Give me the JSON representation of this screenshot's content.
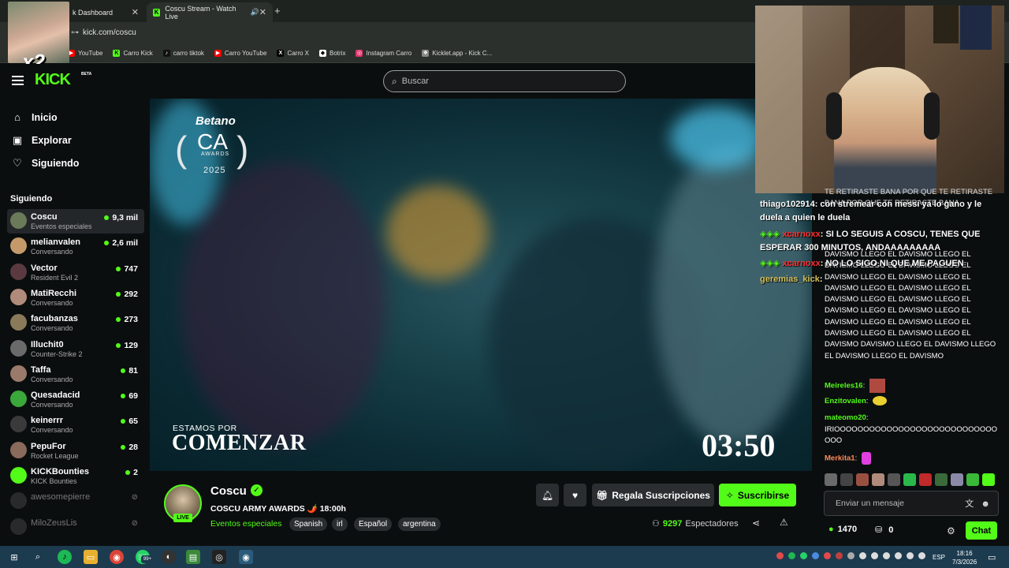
{
  "browser": {
    "tabs": [
      {
        "label": "k Dashboard",
        "active": false
      },
      {
        "label": "Coscu Stream - Watch Live",
        "active": true
      }
    ],
    "url": "kick.com/coscu",
    "bookmarks": [
      {
        "label": "YouTube",
        "icon": "youtube-icon",
        "color": "#ff0000"
      },
      {
        "label": "Carro Kick",
        "icon": "kick-icon",
        "color": "#53fc18"
      },
      {
        "label": "carro tiktok",
        "icon": "tiktok-icon",
        "color": "#111111"
      },
      {
        "label": "Carro YouTube",
        "icon": "youtube-icon",
        "color": "#ff0000"
      },
      {
        "label": "Carro X",
        "icon": "x-icon",
        "color": "#000000"
      },
      {
        "label": "Botrix",
        "icon": "botrix-icon",
        "color": "#ffffff"
      },
      {
        "label": "Instagram Carro",
        "icon": "instagram-icon",
        "color": "#e1306c"
      },
      {
        "label": "Kicklet.app - Kick C...",
        "icon": "kicklet-icon",
        "color": "#888888"
      }
    ]
  },
  "overlay": {
    "multiplier": "x2"
  },
  "header": {
    "logo": "KICK",
    "beta": "BETA",
    "search_placeholder": "Buscar"
  },
  "sidebar": {
    "nav": [
      {
        "label": "Inicio",
        "icon": "home-icon"
      },
      {
        "label": "Explorar",
        "icon": "explore-icon"
      },
      {
        "label": "Siguiendo",
        "icon": "heart-icon"
      }
    ],
    "following_heading": "Siguiendo",
    "channels": [
      {
        "name": "Coscu",
        "category": "Eventos especiales",
        "viewers": "9,3 mil",
        "live": true,
        "color": "#6b7a58"
      },
      {
        "name": "melianvalen",
        "category": "Conversando",
        "viewers": "2,6 mil",
        "live": true,
        "color": "#c49a6a"
      },
      {
        "name": "Vector",
        "category": "Resident Evil 2",
        "viewers": "747",
        "live": true,
        "color": "#5a3a40"
      },
      {
        "name": "MatiRecchi",
        "category": "Conversando",
        "viewers": "292",
        "live": true,
        "color": "#b08a7a"
      },
      {
        "name": "facubanzas",
        "category": "Conversando",
        "viewers": "273",
        "live": true,
        "color": "#8a7a5a"
      },
      {
        "name": "Illuchit0",
        "category": "Counter-Strike 2",
        "viewers": "129",
        "live": true,
        "color": "#6a6a6a"
      },
      {
        "name": "Taffa",
        "category": "Conversando",
        "viewers": "81",
        "live": true,
        "color": "#9a7a6a"
      },
      {
        "name": "Quesadacid",
        "category": "Conversando",
        "viewers": "69",
        "live": true,
        "color": "#3aa83a"
      },
      {
        "name": "keinerrr",
        "category": "Conversando",
        "viewers": "65",
        "live": true,
        "color": "#3a3a3a"
      },
      {
        "name": "PepuFor",
        "category": "Rocket League",
        "viewers": "28",
        "live": true,
        "color": "#8a6a5a"
      },
      {
        "name": "KICKBounties",
        "category": "KICK Bounties",
        "viewers": "2",
        "live": true,
        "color": "#53fc18"
      },
      {
        "name": "awesomepierre",
        "category": "",
        "viewers": "",
        "live": false,
        "color": "#555555"
      },
      {
        "name": "MiloZeusLis",
        "category": "",
        "viewers": "",
        "live": false,
        "color": "#555555"
      }
    ]
  },
  "video": {
    "sponsor": "Betano",
    "event_short": "CA",
    "event_word": "AWARDS",
    "event_year": "2025",
    "caption_small": "ESTAMOS POR",
    "caption_big": "COMENZAR",
    "countdown": "03:50"
  },
  "chat": {
    "overlay_messages": [
      {
        "user": "thiago102914",
        "text": ": con stremear con messi ya lo gano y le duela a quien le duela",
        "color": "#ffffff"
      },
      {
        "user": "xcarnoxx",
        "text": ": SI LO SEGUIS A COSCU, TENES QUE ESPERAR 300 MINUTOS, ANDAAAAAAAAA",
        "color": "#ff3030"
      },
      {
        "user": "xcarnoxx",
        "text": ": NO LO SIGO NI QUE ME PAGUEN",
        "color": "#ff3030"
      },
      {
        "user": "geremias_kick",
        "text": ":",
        "color": "#d4c05a"
      }
    ],
    "background_top": "TE RETIRASTE BANA  POR QUE TE RETIRASTE BANA  POR QUE TE RETIRASTE BANA",
    "spam_text": "DAVISMO LLEGO EL DAVISMO LLEGO EL DAVISMO LLEGO EL DAVISMO LLEGO EL DAVISMO LLEGO EL DAVISMO LLEGO EL DAVISMO LLEGO EL DAVISMO LLEGO EL DAVISMO LLEGO EL DAVISMO LLEGO EL DAVISMO LLEGO EL DAVISMO LLEGO EL DAVISMO LLEGO EL DAVISMO LLEGO EL DAVISMO LLEGO EL DAVISMO LLEGO EL DAVISMO DAVISMO LLEGO EL DAVISMO LLEGO EL DAVISMO LLEGO EL DAVISMO",
    "messages": [
      {
        "user": "Meireles16",
        "text": ":",
        "color": "#53fc18"
      },
      {
        "user": "Enzitovalen",
        "text": ":",
        "color": "#53fc18"
      },
      {
        "user": "mateomo20",
        "text": ":",
        "color": "#53fc18"
      },
      {
        "user": "",
        "text": "IRIOOOOOOOOOOOOOOOOOOOOOOOOOOOOOOO",
        "color": "#ffffff"
      },
      {
        "user": "Merkita1",
        "text": ":",
        "color": "#ff8c5a"
      }
    ],
    "input_placeholder": "Enviar un mensaje",
    "points": "1470",
    "chests": "0",
    "chat_button": "Chat"
  },
  "stream": {
    "name": "Coscu",
    "live_badge": "LIVE",
    "title": "COSCU ARMY AWARDS 🌶️ 18:00h",
    "category": "Eventos especiales",
    "tags": [
      "Spanish",
      "irl",
      "Español",
      "argentina"
    ],
    "gift_label": "Regala Suscripciones",
    "subscribe_label": "Suscribirse",
    "viewers": "9297",
    "viewers_label": "Espectadores"
  },
  "taskbar": {
    "lang": "ESP",
    "time": "18:16",
    "date": "7/3/2026",
    "badge": "99+"
  }
}
